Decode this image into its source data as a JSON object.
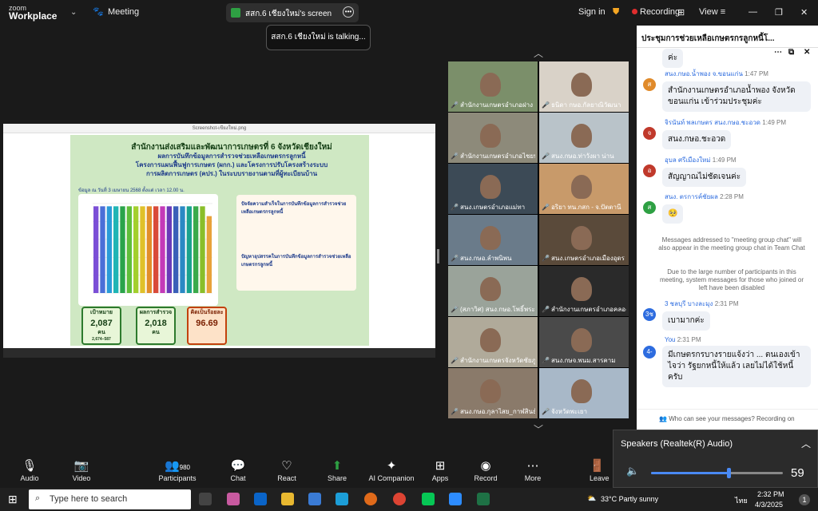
{
  "app": {
    "brand_line1": "zoom",
    "brand_line2": "Workplace",
    "meeting_label": "Meeting"
  },
  "share": {
    "label": "สสก.6 เชียงใหม่'s screen",
    "talking": "สสก.6 เชียงใหม่ is talking..."
  },
  "topbar": {
    "signin": "Sign in",
    "recording": "Recording",
    "view": "View"
  },
  "poster": {
    "window_title": "Screenshot-เขียงใหม่.png",
    "title1": "สำนักงานส่งเสริมและพัฒนาการเกษตรที่ 6 จังหวัดเชียงใหม่",
    "title2": "ผลการบันทึกข้อมูลการสำรวจช่วยเหลือเกษตรกรลูกหนี้",
    "title3": "โครงการแผนฟื้นฟูการเกษตร (ผกก.) และโครงการปรับโครงสร้างระบบ",
    "title4": "การผลิตการเกษตร (คปร.) ในระบบรายงานตามที่ผู้ทะเบียนบ้าน",
    "caption": "ข้อมูล ณ วันที่ 3 เมษายน 2568 ตั้งแต่ เวลา 12.00 น.",
    "box_head1": "ปัจจัยความสำเร็จในการบันทึกข้อมูลการสำรวจช่วยเหลือเกษตรกรลูกหนี้",
    "box_head2": "ปัญหาอุปสรรคในการบันทึกข้อมูลการสำรวจช่วยเหลือเกษตรกรลูกหนี้",
    "kpi1_label": "เป้าหมาย",
    "kpi1_value": "2,087",
    "kpi1_unit": "คน",
    "kpi1_sub": "2,674–587",
    "kpi2_label": "ผลการสำรวจ",
    "kpi2_value": "2,018",
    "kpi2_unit": "คน",
    "kpi3_label": "คิดเป็นร้อยละ",
    "kpi3_value": "96.69"
  },
  "chart_data": {
    "type": "bar",
    "values": [
      97,
      97,
      97,
      97,
      97,
      97,
      97,
      97,
      97,
      97,
      97,
      97,
      97,
      97,
      97,
      97,
      97,
      86
    ],
    "ylim": [
      0,
      100
    ],
    "colors": [
      "#7b4fd6",
      "#4a6fd8",
      "#2a9bd8",
      "#1fb5b5",
      "#2aa44a",
      "#5fbe3a",
      "#a3cf2d",
      "#e0c12a",
      "#e28e2a",
      "#d94a3a",
      "#c43ab8",
      "#6a3ab8",
      "#3a5fb8",
      "#2a89c4",
      "#1aa28e",
      "#3aaa4a",
      "#8abe2a",
      "#e8a23a"
    ]
  },
  "participants": [
    {
      "name": "สำนักงานเกษตรอำเภอฝาง"
    },
    {
      "name": "ธนิดา กษอ.กัลยาณิวัฒนา"
    },
    {
      "name": "สำนักงานเกษตรอำเภอไชยปราการ"
    },
    {
      "name": "สนง.กษอ.ท่าวังผา น่าน"
    },
    {
      "name": "สนง.เกษตรอำเภอแม่ทา"
    },
    {
      "name": "อริยา ทน.กสก - จ.ปัตตานี"
    },
    {
      "name": "สนง.กษอ.ลำพนิพน"
    },
    {
      "name": "สนง.เกษตรอำเภอเมืองอุดร"
    },
    {
      "name": "(สภาวิศ) สนง.กษอ.โพธิ์พระ"
    },
    {
      "name": "สำนักงานเกษตรอำเภอคลองหอย"
    },
    {
      "name": "สำนักงานเกษตรจังหวัดชัยภูมิ"
    },
    {
      "name": "สนง.กษจ.พนม.สารคาม"
    },
    {
      "name": "สนง.กษอ.กุลาไสย_กาฬสินธุ์"
    },
    {
      "name": "จังหวัดพะเยา"
    }
  ],
  "chat": {
    "title": "ประชุมการช่วยเหลือเกษตรกรลูกหนี้โ...",
    "msgs": [
      {
        "who": "สนง.กษอ.น้ำพอง จ.ขอนแก่น",
        "time": "1:47 PM",
        "init": "ส",
        "text": "สำนักงานเกษตรอำเภอน้ำพอง จังหวัดขอนแก่น  เข้าร่วมประชุมค่ะ"
      },
      {
        "who": "จิรนันท์ พลเกษตร สนง.กษอ.ชะอวด",
        "time": "1:49 PM",
        "init": "จ",
        "text": "สนง.กษอ.ชะอวด"
      },
      {
        "who": "อุบล ศรีเมืองใหม่",
        "time": "1:49 PM",
        "init": "อ",
        "text": "สัญญาณไม่ชัดเจนค่ะ"
      },
      {
        "who": "สนง. ตรการค์ชัยผล",
        "time": "2:28 PM",
        "init": "ส",
        "text": "🥺"
      },
      {
        "who": "3 ชลบุรี บางละมุง",
        "time": "2:31 PM",
        "init": "3ช",
        "text": "เบามากค่ะ"
      },
      {
        "who": "You",
        "time": "2:31 PM",
        "init": "4-",
        "text": "มีเกษตรกรบางรายแจ้งว่า ... ตนเองเข้าไจว่า รัฐยกหนี้ให้แล้ว  เลยไม่ได้ใช้หนี้ ครับ"
      }
    ],
    "top_bubble": "ค่ะ",
    "sys1": "Messages addressed to \"meeting group chat\" will also appear in the meeting group chat in Team Chat",
    "sys2": "Due to the large number of participants in this meeting, system messages for those who joined or left have been disabled",
    "footer": "Who can see your messages? Recording on"
  },
  "audio": {
    "device": "Speakers (Realtek(R) Audio)",
    "volume": "59",
    "level": 0.59
  },
  "dock": {
    "audio": "Audio",
    "video": "Video",
    "participants": "Participants",
    "participants_count": "980",
    "chat": "Chat",
    "react": "React",
    "share": "Share",
    "ai": "AI Companion",
    "apps": "Apps",
    "record": "Record",
    "more": "More",
    "leave": "Leave"
  },
  "taskbar": {
    "search": "Type here to search",
    "weather": "33°C  Partly sunny",
    "lang": "ไทย",
    "time": "2:32 PM",
    "date": "4/3/2025",
    "notif": "1"
  }
}
